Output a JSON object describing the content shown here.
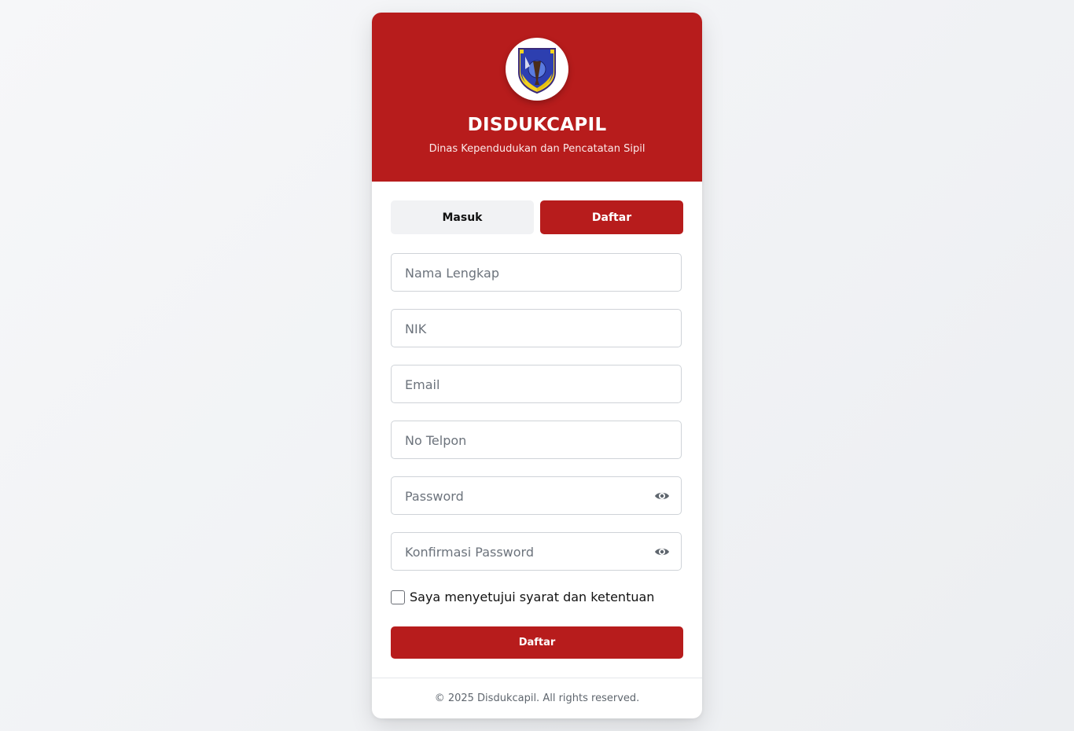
{
  "header": {
    "title": "DISDUKCAPIL",
    "subtitle": "Dinas Kependudukan dan Pencatatan Sipil"
  },
  "tabs": [
    {
      "label": "Masuk",
      "active": false
    },
    {
      "label": "Daftar",
      "active": true
    }
  ],
  "form": {
    "fields": [
      {
        "placeholder": "Nama Lengkap",
        "value": ""
      },
      {
        "placeholder": "NIK",
        "value": ""
      },
      {
        "placeholder": "Email",
        "value": ""
      },
      {
        "placeholder": "No Telpon",
        "value": ""
      },
      {
        "placeholder": "Password",
        "value": "",
        "icon": "eye-icon"
      },
      {
        "placeholder": "Konfirmasi Password",
        "value": "",
        "icon": "eye-icon"
      }
    ],
    "terms_label": "Saya menyetujui syarat dan ketentuan",
    "terms_checked": false,
    "submit_label": "Daftar"
  },
  "footer": {
    "copyright": "© 2025 Disdukcapil. All rights reserved."
  },
  "colors": {
    "primary": "#b71c1c",
    "tab_inactive_bg": "#f1f2f4"
  }
}
